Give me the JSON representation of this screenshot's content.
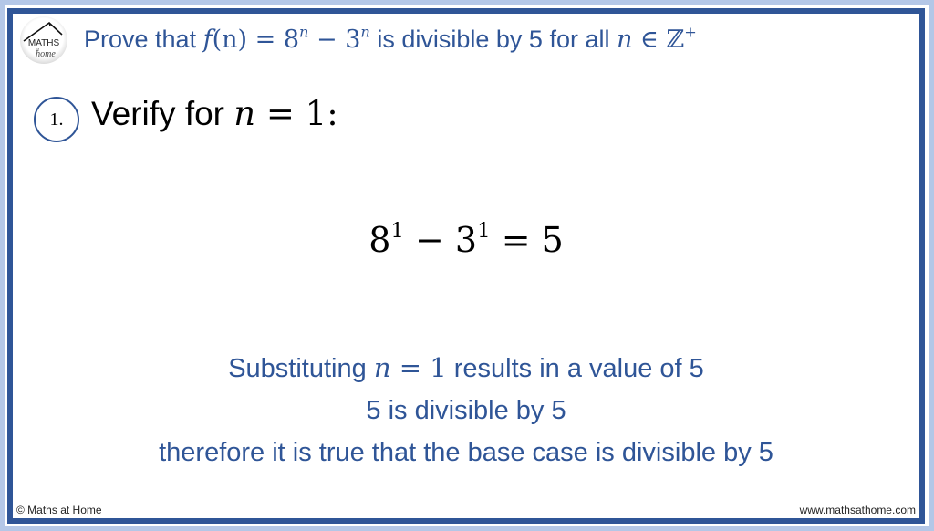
{
  "logo": {
    "line1": "MATHS",
    "line2": "at",
    "line3": "home"
  },
  "title": {
    "prefix": "Prove that ",
    "func": "f",
    "arg": "(n)",
    "equals": " = 8",
    "exp1": "n",
    "minus": " − 3",
    "exp2": "n",
    "middle": " is divisible by 5 for all ",
    "var": "n",
    "member": " ∈ ℤ",
    "plus": "+"
  },
  "step": {
    "number": "1.",
    "label": "Verify for ",
    "var": "n",
    "rest": " = 1:"
  },
  "equation": {
    "base1": "8",
    "exp1": "1",
    "minus": " − 3",
    "exp2": "1",
    "result": " = 5"
  },
  "explanation": {
    "line1_prefix": "Substituting ",
    "line1_var": "n",
    "line1_eq": " = 1",
    "line1_suffix": " results in a value of 5",
    "line2": "5 is divisible by 5",
    "line3": "therefore it is true that the base case is divisible by 5"
  },
  "footer": {
    "copyright": "© Maths at Home",
    "website": "www.mathsathome.com"
  },
  "colors": {
    "accent": "#2f5597",
    "outer_band": "#b4c7e7",
    "text": "#000000"
  }
}
